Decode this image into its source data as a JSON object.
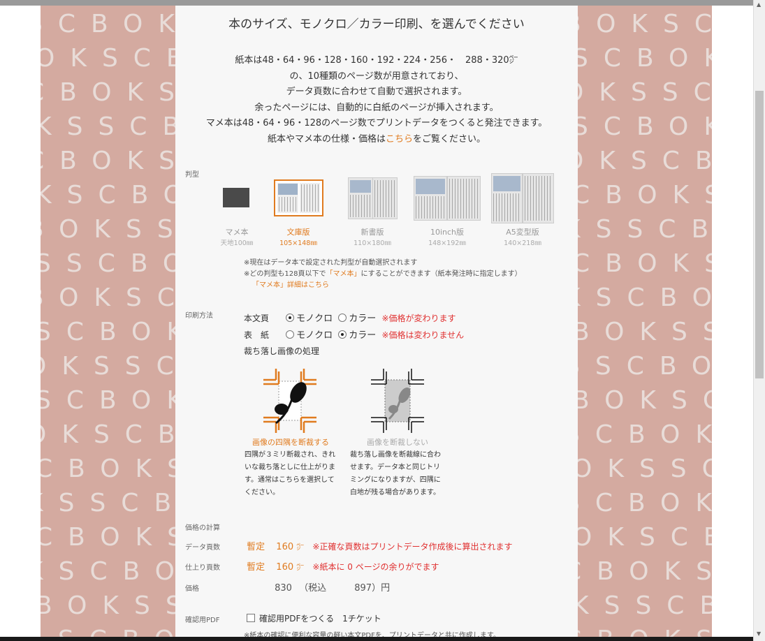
{
  "heading": "本のサイズ、モノクロ／カラー印刷、を選んでください",
  "intro": {
    "line1": "紙本は48・64・96・128・160・192・224・256・　288・320㌻",
    "line2": "の、10種類のページ数が用意されており、",
    "line3": "データ頁数に合わせて自動で選択されます。",
    "line4": "余ったページには、自動的に白紙のページが挿入されます。",
    "line5": "マメ本は48・64・96・128のページ数でプリントデータをつくると発注できます。",
    "line6_pre": "紙本やマメ本の仕様・価格は",
    "line6_link": "こちら",
    "line6_post": "をご覧ください。"
  },
  "pattern_text": "SCBOKSCBOKS",
  "size": {
    "label": "判型",
    "options": [
      {
        "name": "マメ本",
        "dim": "天地100㎜",
        "selected": false
      },
      {
        "name": "文庫版",
        "dim": "105×148㎜",
        "selected": true
      },
      {
        "name": "新書版",
        "dim": "110×180㎜",
        "selected": false
      },
      {
        "name": "10inch版",
        "dim": "148×192㎜",
        "selected": false
      },
      {
        "name": "A5変型版",
        "dim": "140×218㎜",
        "selected": false
      }
    ],
    "note1": "※現在はデータ本で設定された判型が自動選択されます",
    "note2_pre": "※どの判型も128頁以下で",
    "note2_link": "「マメ本」",
    "note2_post": "にすることができます（紙本発注時に指定します）",
    "note3": "「マメ本」詳細はこちら"
  },
  "print": {
    "label": "印刷方法",
    "body_label": "本文頁",
    "cover_label": "表　紙",
    "mono": "モノクロ",
    "color": "カラー",
    "body_note": "※価格が変わります",
    "cover_note": "※価格は変わりません",
    "bleed_title": "裁ち落し画像の処理",
    "bleed_opt1": "画像の四隅を断裁する",
    "bleed_desc1": [
      "四隅が３ミリ断裁され、きれ",
      "いな裁ち落としに仕上がりま",
      "す。通常はこちらを選択して",
      "ください。"
    ],
    "bleed_opt2": "画像を断裁しない",
    "bleed_desc2": [
      "裁ち落し画像を断裁線に合わ",
      "せます。データ本と同じトリ",
      "ミングになりますが、四隅に",
      "白地が残る場合があります。"
    ]
  },
  "calc": {
    "label": "価格の計算",
    "data_pages_label": "データ頁数",
    "tentative": "暫定",
    "data_pages": "160",
    "page_unit": "㌻",
    "data_pages_note": "※正確な頁数はプリントデータ作成後に算出されます",
    "final_pages_label": "仕上り頁数",
    "final_pages": "160",
    "final_pages_note": "※紙本に 0 ページの余りがでます",
    "price_label": "価格",
    "price": "830",
    "tax_label": "（税込",
    "price_tax": "897）円"
  },
  "pdf": {
    "label": "確認用PDF",
    "checkbox_label": "確認用PDFをつくる　1チケット",
    "note": "※紙本の確認に便利な容量の軽い本文PDFを、プリントデータと共に作成します。"
  },
  "colors": {
    "accent": "#e07b1f",
    "warning": "#e03030",
    "pattern_bg": "#d4aaa0"
  }
}
